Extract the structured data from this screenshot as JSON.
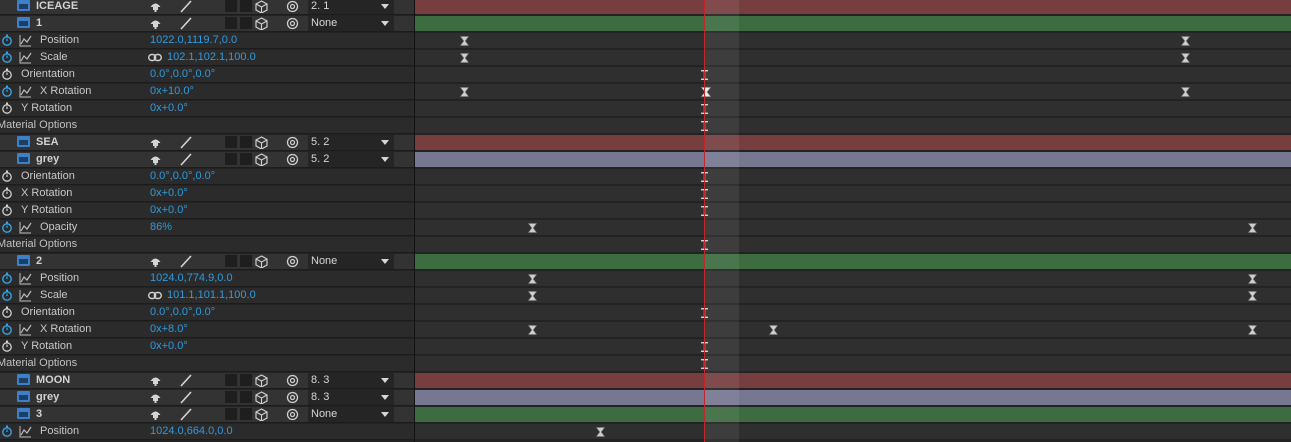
{
  "colors": {
    "layer_red": "#773e40",
    "layer_green": "#3d6c41",
    "layer_grey": "#787792",
    "value_blue": "#2f9bde",
    "playhead": "#c0262b"
  },
  "rows": [
    {
      "kind": "layer",
      "name": "ICEAGE",
      "parent": "2. 1",
      "track": "red"
    },
    {
      "kind": "layer",
      "name": "1",
      "parent": "None",
      "track": "green"
    },
    {
      "kind": "prop",
      "name": "Position",
      "value": "1022.0,1119.7,0.0",
      "graph": true,
      "keys": [
        {
          "t": 0.056
        },
        {
          "t": 0.879
        }
      ]
    },
    {
      "kind": "prop",
      "name": "Scale",
      "value": "102.1,102.1,100.0",
      "graph": true,
      "linked": true,
      "keys": [
        {
          "t": 0.056
        },
        {
          "t": 0.879
        }
      ]
    },
    {
      "kind": "prop",
      "name": "Orientation",
      "value": "0.0°,0.0°,0.0°",
      "graph": false,
      "keys": [
        {
          "t": 0.331,
          "m": "marker"
        }
      ]
    },
    {
      "kind": "prop",
      "name": "X Rotation",
      "value": "0x+10.0°",
      "graph": true,
      "keys": [
        {
          "t": 0.056
        },
        {
          "t": 0.332,
          "m": "sel"
        },
        {
          "t": 0.879
        }
      ]
    },
    {
      "kind": "prop",
      "name": "Y Rotation",
      "value": "0x+0.0°",
      "graph": false,
      "keys": [
        {
          "t": 0.331,
          "m": "marker"
        }
      ]
    },
    {
      "kind": "section",
      "name": "Material Options",
      "keys": [
        {
          "t": 0.331,
          "m": "marker"
        }
      ]
    },
    {
      "kind": "layer",
      "name": "SEA",
      "parent": "5. 2",
      "track": "red"
    },
    {
      "kind": "layer",
      "name": "grey",
      "parent": "5. 2",
      "track": "grey"
    },
    {
      "kind": "prop",
      "name": "Orientation",
      "value": "0.0°,0.0°,0.0°",
      "graph": false,
      "keys": [
        {
          "t": 0.331,
          "m": "marker"
        }
      ]
    },
    {
      "kind": "prop",
      "name": "X Rotation",
      "value": "0x+0.0°",
      "graph": false,
      "keys": [
        {
          "t": 0.331,
          "m": "marker"
        }
      ]
    },
    {
      "kind": "prop",
      "name": "Y Rotation",
      "value": "0x+0.0°",
      "graph": false,
      "keys": [
        {
          "t": 0.331,
          "m": "marker"
        }
      ]
    },
    {
      "kind": "prop",
      "name": "Opacity",
      "value": "86%",
      "graph": true,
      "keys": [
        {
          "t": 0.134
        },
        {
          "t": 0.956
        }
      ]
    },
    {
      "kind": "section",
      "name": "Material Options",
      "keys": [
        {
          "t": 0.331,
          "m": "marker"
        }
      ]
    },
    {
      "kind": "layer",
      "name": "2",
      "parent": "None",
      "track": "green"
    },
    {
      "kind": "prop",
      "name": "Position",
      "value": "1024.0,774.9,0.0",
      "graph": true,
      "keys": [
        {
          "t": 0.134
        },
        {
          "t": 0.956
        }
      ]
    },
    {
      "kind": "prop",
      "name": "Scale",
      "value": "101.1,101.1,100.0",
      "graph": true,
      "linked": true,
      "keys": [
        {
          "t": 0.134
        },
        {
          "t": 0.956
        }
      ]
    },
    {
      "kind": "prop",
      "name": "Orientation",
      "value": "0.0°,0.0°,0.0°",
      "graph": false,
      "keys": [
        {
          "t": 0.331,
          "m": "marker"
        }
      ]
    },
    {
      "kind": "prop",
      "name": "X Rotation",
      "value": "0x+8.0°",
      "graph": true,
      "keys": [
        {
          "t": 0.134
        },
        {
          "t": 0.409
        },
        {
          "t": 0.956
        }
      ]
    },
    {
      "kind": "prop",
      "name": "Y Rotation",
      "value": "0x+0.0°",
      "graph": false,
      "keys": [
        {
          "t": 0.331,
          "m": "marker"
        }
      ]
    },
    {
      "kind": "section",
      "name": "Material Options",
      "keys": [
        {
          "t": 0.331,
          "m": "marker"
        }
      ]
    },
    {
      "kind": "layer",
      "name": "MOON",
      "parent": "8. 3",
      "track": "red"
    },
    {
      "kind": "layer",
      "name": "grey",
      "parent": "8. 3",
      "track": "grey"
    },
    {
      "kind": "layer",
      "name": "3",
      "parent": "None",
      "track": "green"
    },
    {
      "kind": "prop",
      "name": "Position",
      "value": "1024.0,664.0,0.0",
      "graph": true,
      "keys": [
        {
          "t": 0.212
        }
      ]
    }
  ]
}
